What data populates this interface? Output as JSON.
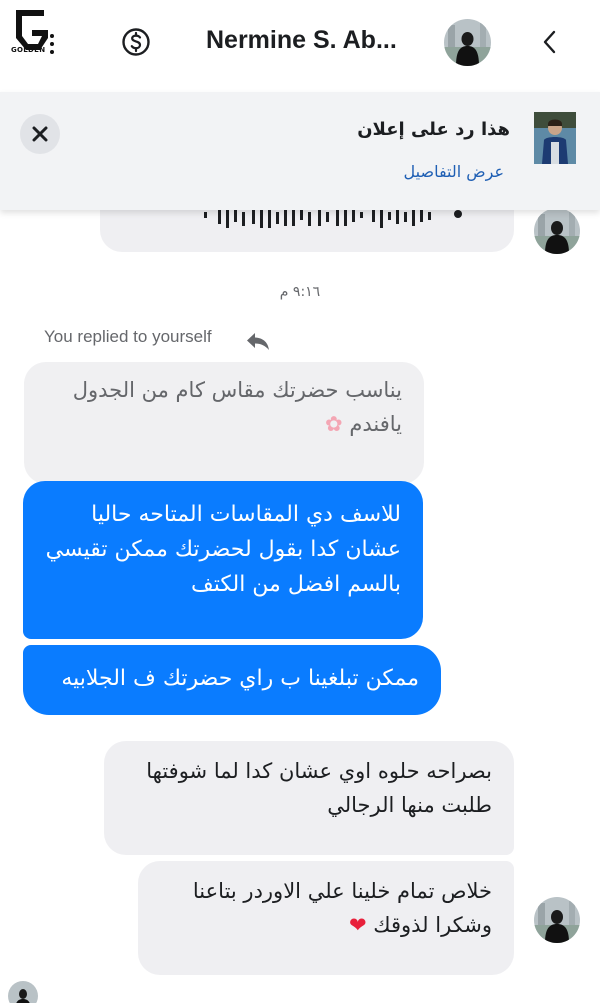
{
  "header": {
    "logo_text": "GOLDEN",
    "title": "Nermine S. Ab...",
    "dollar_icon": "dollar-circle-icon",
    "back_icon": "chevron-right-icon"
  },
  "ad_banner": {
    "title": "هذا رد على إعلان",
    "details_link": "عرض التفاصيل",
    "close_icon": "close-icon"
  },
  "conversation": {
    "timestamp": "٩:١٦ م",
    "replied_label": "You replied to yourself",
    "quoted_message": {
      "line1": "يناسب حضرتك مقاس كام من الجدول",
      "line2": "يافندم",
      "emoji": "✿"
    },
    "outgoing": [
      {
        "line1": "للاسف دي المقاسات المتاحه حاليا",
        "line2": "عشان كدا بقول لحضرتك ممكن تقيسي",
        "line3": "بالسم افضل من الكتف"
      },
      {
        "line1": "ممكن تبلغينا ب راي حضرتك ف الجلابيه"
      }
    ],
    "incoming": [
      {
        "line1": "بصراحه حلوه اوي عشان كدا لما شوفتها",
        "line2": "طلبت منها الرجالي"
      },
      {
        "line1": "خلاص تمام خلينا علي الاوردر بتاعنا",
        "line2": "وشكرا لذوقك",
        "emoji": "❤"
      }
    ]
  },
  "colors": {
    "outgoing_bubble": "#0a7cff",
    "incoming_bubble": "#efeff2",
    "link": "#1f5fb4"
  }
}
